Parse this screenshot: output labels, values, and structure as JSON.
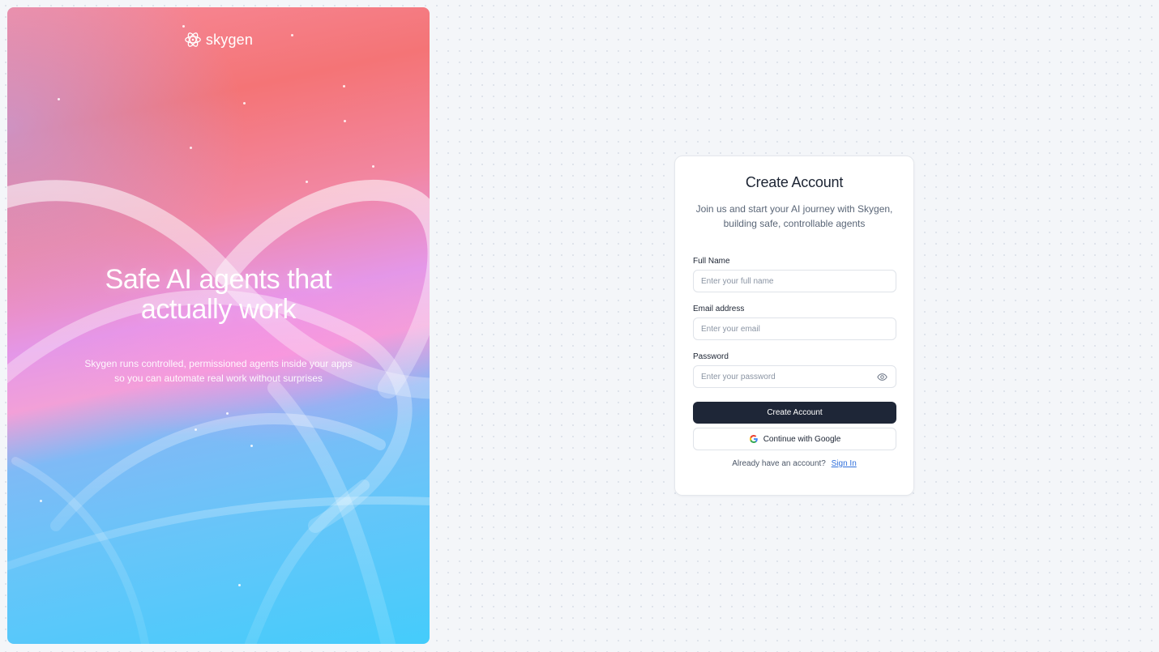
{
  "hero": {
    "brand_name": "skygen",
    "logo_icon": "atom-logo-icon",
    "title_line1": "Safe AI agents that",
    "title_line2": "actually work",
    "subtitle_line1": "Skygen runs controlled, permissioned agents inside your apps",
    "subtitle_line2": "so you can automate real work without surprises"
  },
  "card": {
    "title": "Create Account",
    "subtitle_line1": "Join us and start your AI journey with Skygen,",
    "subtitle_line2": "building safe, controllable agents",
    "fields": {
      "full_name": {
        "label": "Full Name",
        "placeholder": "Enter your full name"
      },
      "email": {
        "label": "Email address",
        "placeholder": "Enter your email"
      },
      "password": {
        "label": "Password",
        "placeholder": "Enter your password",
        "toggle_icon": "eye-icon"
      }
    },
    "primary_button": "Create Account",
    "google_button": "Continue with Google",
    "signin_prompt": "Already have an account?",
    "signin_link": "Sign In"
  },
  "colors": {
    "primary_button": "#1e2637",
    "link": "#2f6fdb",
    "page_bg": "#f4f6f9"
  }
}
